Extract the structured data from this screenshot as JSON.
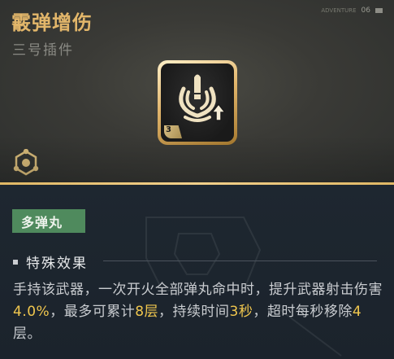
{
  "item": {
    "title": "霰弹增伤",
    "subtitle": "三号插件",
    "level": "3"
  },
  "corner": {
    "label": "ADVENTURE",
    "number": "06"
  },
  "tag": "多弹丸",
  "section": {
    "title": "特殊效果"
  },
  "description": {
    "p1": "手持该武器，一次开火全部弹丸命中时，提升武器射击伤害",
    "v1": "4.0%",
    "p2": "，最多可累计",
    "v2": "8层",
    "p3": "，持续时间",
    "v3": "3秒",
    "p4": "，超时每秒移除",
    "v4": "4",
    "p5": "层。"
  },
  "colors": {
    "title": "#e2b66a",
    "highlight": "#f1c74e",
    "tag_bg": "#4f8a5d",
    "gold_line": "#e0b865"
  },
  "icons": {
    "item_icon": "bullet-spread-up-icon",
    "category_icon": "hexagon-node-icon"
  }
}
